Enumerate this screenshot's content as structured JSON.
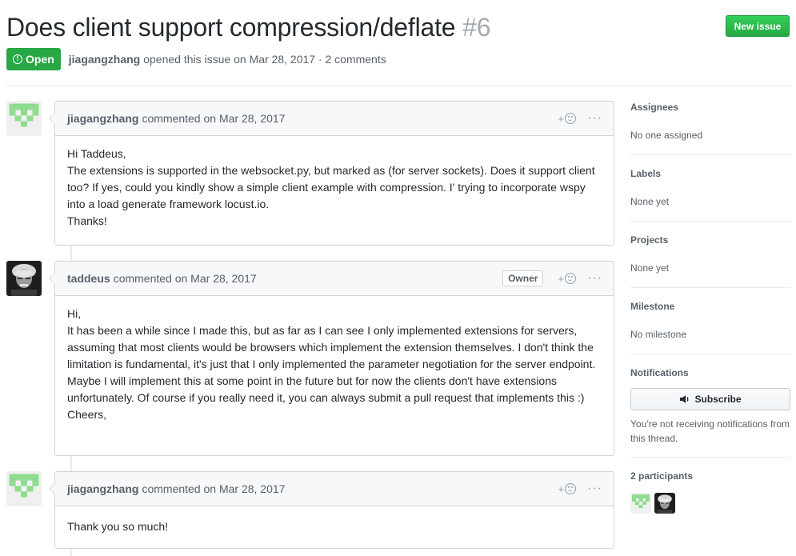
{
  "issue": {
    "title": "Does client support compression/deflate",
    "number": "#6",
    "state": "Open",
    "author": "jiagangzhang",
    "meta_text": "opened this issue on Mar 28, 2017 · 2 comments",
    "new_issue_label": "New issue"
  },
  "comments": [
    {
      "author": "jiagangzhang",
      "action": "commented on Mar 28, 2017",
      "badge": "",
      "body": "Hi Taddeus,\nThe extensions is supported in the websocket.py, but marked as (for server sockets). Does it support client too? If yes, could you kindly show a simple client example with compression. I' trying to incorporate wspy into a load generate framework locust.io.\nThanks!"
    },
    {
      "author": "taddeus",
      "action": "commented on Mar 28, 2017",
      "badge": "Owner",
      "body": "Hi,\nIt has been a while since I made this, but as far as I can see I only implemented extensions for servers, assuming that most clients would be browsers which implement the extension themselves. I don't think the limitation is fundamental, it's just that I only implemented the parameter negotiation for the server endpoint. Maybe I will implement this at some point in the future but for now the clients don't have extensions unfortunately. Of course if you really need it, you can always submit a pull request that implements this :)\nCheers,"
    },
    {
      "author": "jiagangzhang",
      "action": "commented on Mar 28, 2017",
      "badge": "",
      "body": "Thank you so much!"
    }
  ],
  "comment_actions": {
    "reaction_plus": "+",
    "more": "···"
  },
  "sidebar": {
    "assignees": {
      "heading": "Assignees",
      "value": "No one assigned"
    },
    "labels": {
      "heading": "Labels",
      "value": "None yet"
    },
    "projects": {
      "heading": "Projects",
      "value": "None yet"
    },
    "milestone": {
      "heading": "Milestone",
      "value": "No milestone"
    },
    "notifications": {
      "heading": "Notifications",
      "button_label": "Subscribe",
      "note": "You’re not receiving notifications from this thread."
    },
    "participants": {
      "heading": "2 participants"
    }
  },
  "colors": {
    "open_green": "#28a745",
    "identicon_green": "#8fdc8f"
  },
  "icons": {
    "state": "issue-opened-icon",
    "subscribe": "speaker-icon",
    "reaction": "smiley-icon",
    "more": "kebab-icon"
  }
}
